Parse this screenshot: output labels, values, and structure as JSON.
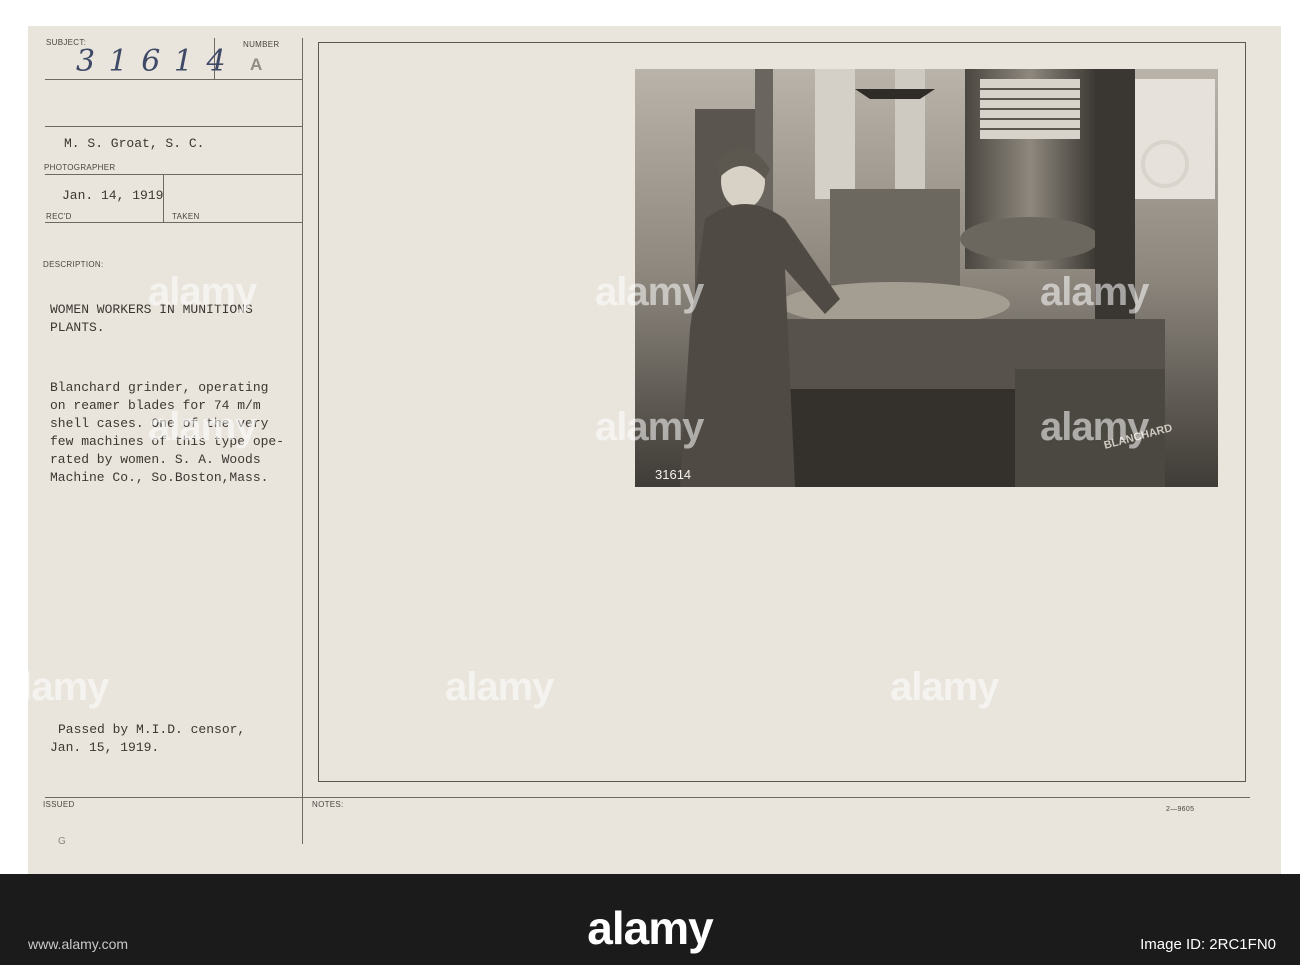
{
  "card": {
    "subject_label": "SUBJECT:",
    "subject_number": "3 1 6 1 4",
    "number_label": "NUMBER",
    "number_value": "A",
    "photographer_name": "M. S. Groat, S. C.",
    "photographer_label": "PHOTOGRAPHER",
    "received_date": "Jan. 14, 1919",
    "received_label": "REC'D",
    "taken_label": "TAKEN",
    "description_label": "DESCRIPTION:",
    "heading_lines": [
      "WOMEN WORKERS IN MUNITIONS",
      "PLANTS."
    ],
    "body_lines": [
      "Blanchard grinder, operating",
      "on reamer blades for 74 m/m",
      "shell cases. One of the very",
      "few machines of this type ope-",
      "rated by women. S. A. Woods",
      "Machine Co., So.Boston,Mass."
    ],
    "censor_lines": [
      "Passed by M.I.D. censor,",
      "Jan. 15, 1919."
    ],
    "issued_label": "ISSUED",
    "issued_value": "G",
    "notes_label": "NOTES:",
    "form_code": "2—9605"
  },
  "photo": {
    "negative_number": "31614",
    "machine_plate": "BLANCHARD"
  },
  "watermarks": [
    "alamy",
    "alamy",
    "alamy",
    "alamy",
    "alamy",
    "alamy",
    "alamy",
    "alamy",
    "alamy"
  ],
  "footer": {
    "brand": "alamy",
    "image_id": "Image ID: 2RC1FN0",
    "site": "www.alamy.com"
  },
  "colors": {
    "card": "#e9e4dc",
    "ink": "#3b3832",
    "handwriting": "#3f4a66",
    "stage": "#1b1b1b"
  }
}
